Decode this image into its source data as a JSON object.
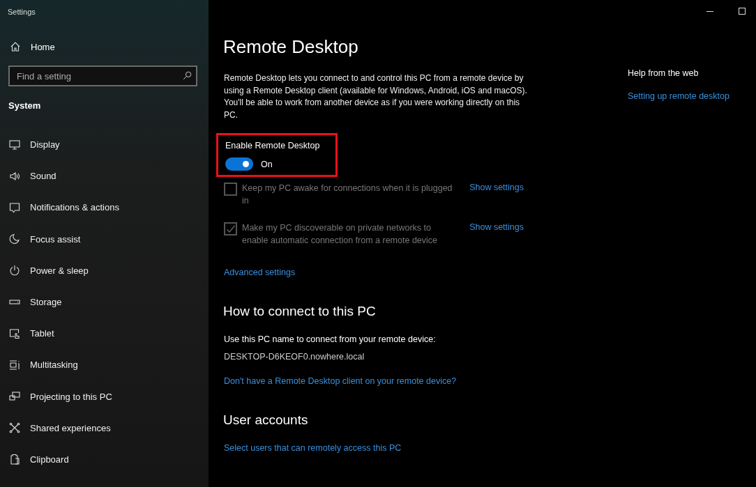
{
  "window": {
    "title": "Settings"
  },
  "sidebar": {
    "home": "Home",
    "search": {
      "placeholder": "Find a setting"
    },
    "section": "System",
    "items": [
      {
        "label": "Display",
        "selected": false
      },
      {
        "label": "Sound",
        "selected": false
      },
      {
        "label": "Notifications & actions",
        "selected": false
      },
      {
        "label": "Focus assist",
        "selected": false
      },
      {
        "label": "Power & sleep",
        "selected": false
      },
      {
        "label": "Storage",
        "selected": false
      },
      {
        "label": "Tablet",
        "selected": false
      },
      {
        "label": "Multitasking",
        "selected": false
      },
      {
        "label": "Projecting to this PC",
        "selected": false
      },
      {
        "label": "Shared experiences",
        "selected": false
      },
      {
        "label": "Clipboard",
        "selected": false
      }
    ]
  },
  "page": {
    "title": "Remote Desktop",
    "description": "Remote Desktop lets you connect to and control this PC from a remote device by using a Remote Desktop client (available for Windows, Android, iOS and macOS). You'll be able to work from another device as if you were working directly on this PC.",
    "toggle": {
      "label": "Enable Remote Desktop",
      "on": true,
      "state_text": "On",
      "highlighted": true
    },
    "options": [
      {
        "label": "Keep my PC awake for connections when it is plugged in",
        "checked": false,
        "disabled": true,
        "link": "Show settings"
      },
      {
        "label": "Make my PC discoverable on private networks to enable automatic connection from a remote device",
        "checked": true,
        "disabled": true,
        "link": "Show settings"
      }
    ],
    "advanced_link": "Advanced settings",
    "connect": {
      "heading": "How to connect to this PC",
      "instruction": "Use this PC name to connect from your remote device:",
      "pc_name": "DESKTOP-D6KEOF0.nowhere.local",
      "link": "Don't have a Remote Desktop client on your remote device?"
    },
    "accounts": {
      "heading": "User accounts",
      "link": "Select users that can remotely access this PC"
    }
  },
  "help": {
    "heading": "Help from the web",
    "link": "Setting up remote desktop"
  }
}
